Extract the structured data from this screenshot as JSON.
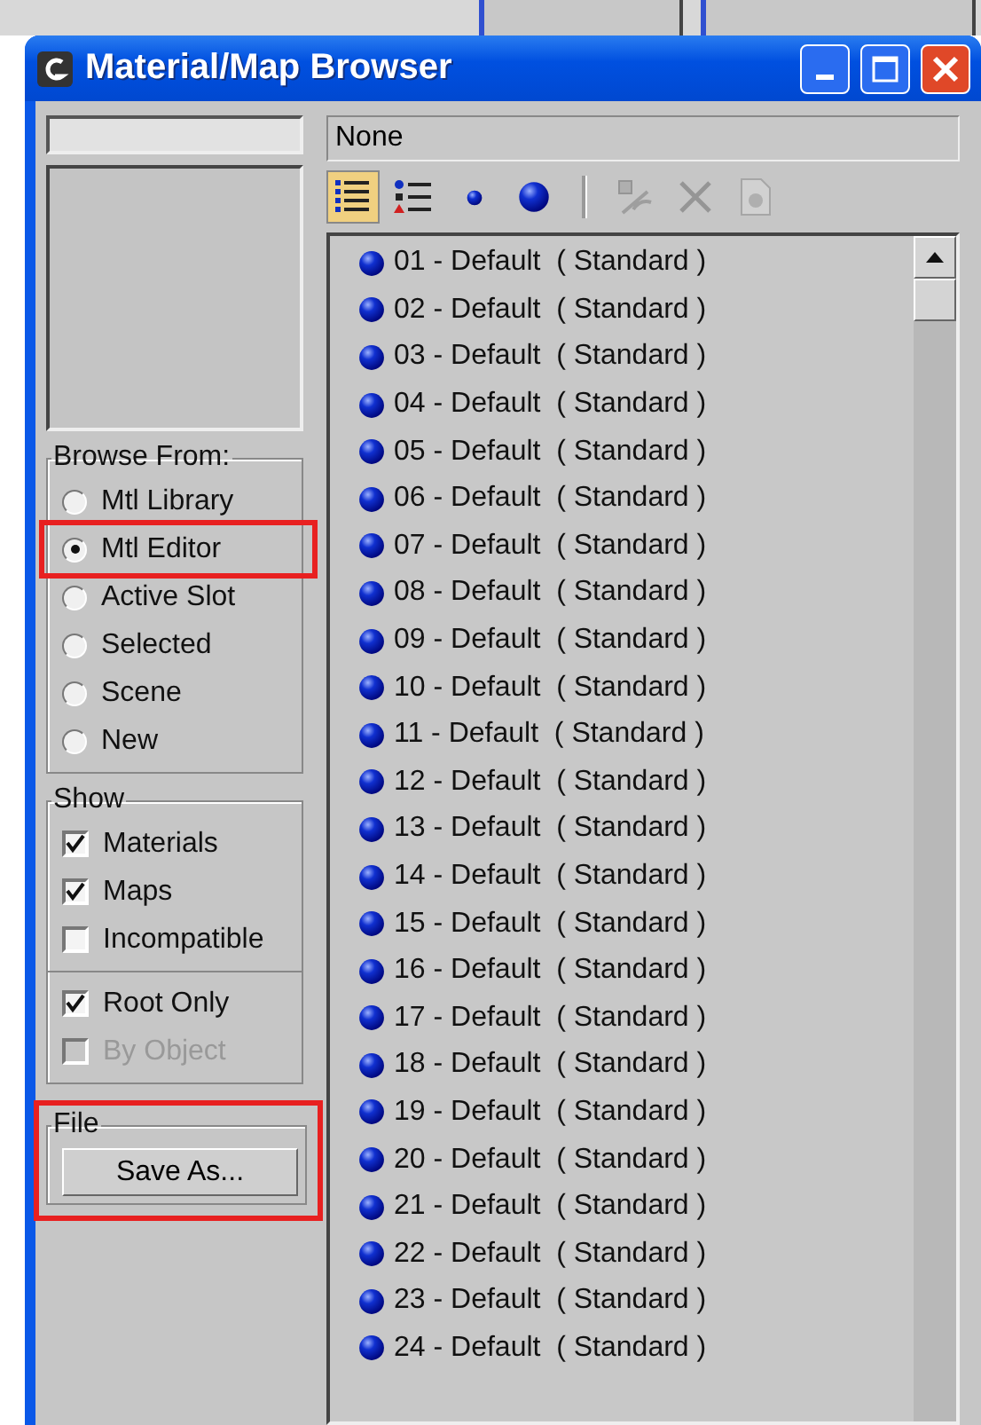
{
  "window": {
    "title": "Material/Map Browser"
  },
  "current": {
    "value": "None"
  },
  "toolbar": [
    {
      "kind": "view",
      "selected": true,
      "disabled": false
    },
    {
      "kind": "view",
      "selected": false,
      "disabled": false
    },
    {
      "kind": "view",
      "selected": false,
      "disabled": false
    },
    {
      "kind": "view",
      "selected": false,
      "disabled": false
    },
    {
      "kind": "separator"
    },
    {
      "kind": "action",
      "selected": false,
      "disabled": true
    },
    {
      "kind": "action",
      "selected": false,
      "disabled": true
    },
    {
      "kind": "action",
      "selected": false,
      "disabled": true
    }
  ],
  "browse_from": {
    "title": "Browse From:",
    "options": [
      {
        "label": "Mtl Library",
        "selected": false,
        "highlighted": false
      },
      {
        "label": "Mtl Editor",
        "selected": true,
        "highlighted": true
      },
      {
        "label": "Active Slot",
        "selected": false,
        "highlighted": false
      },
      {
        "label": "Selected",
        "selected": false,
        "highlighted": false
      },
      {
        "label": "Scene",
        "selected": false,
        "highlighted": false
      },
      {
        "label": "New",
        "selected": false,
        "highlighted": false
      }
    ]
  },
  "show": {
    "title": "Show",
    "options": [
      {
        "label": "Materials",
        "checked": true,
        "disabled": false
      },
      {
        "label": "Maps",
        "checked": true,
        "disabled": false
      },
      {
        "label": "Incompatible",
        "checked": false,
        "disabled": false
      }
    ],
    "extra": [
      {
        "label": "Root Only",
        "checked": true,
        "disabled": false
      },
      {
        "label": "By Object",
        "checked": false,
        "disabled": true
      }
    ]
  },
  "file": {
    "title": "File",
    "button": "Save As...",
    "highlighted": true
  },
  "materials": [
    "01 - Default  ( Standard )",
    "02 - Default  ( Standard )",
    "03 - Default  ( Standard )",
    "04 - Default  ( Standard )",
    "05 - Default  ( Standard )",
    "06 - Default  ( Standard )",
    "07 - Default  ( Standard )",
    "08 - Default  ( Standard )",
    "09 - Default  ( Standard )",
    "10 - Default  ( Standard )",
    "11 - Default  ( Standard )",
    "12 - Default  ( Standard )",
    "13 - Default  ( Standard )",
    "14 - Default  ( Standard )",
    "15 - Default  ( Standard )",
    "16 - Default  ( Standard )",
    "17 - Default  ( Standard )",
    "18 - Default  ( Standard )",
    "19 - Default  ( Standard )",
    "20 - Default  ( Standard )",
    "21 - Default  ( Standard )",
    "22 - Default  ( Standard )",
    "23 - Default  ( Standard )",
    "24 - Default  ( Standard )"
  ]
}
